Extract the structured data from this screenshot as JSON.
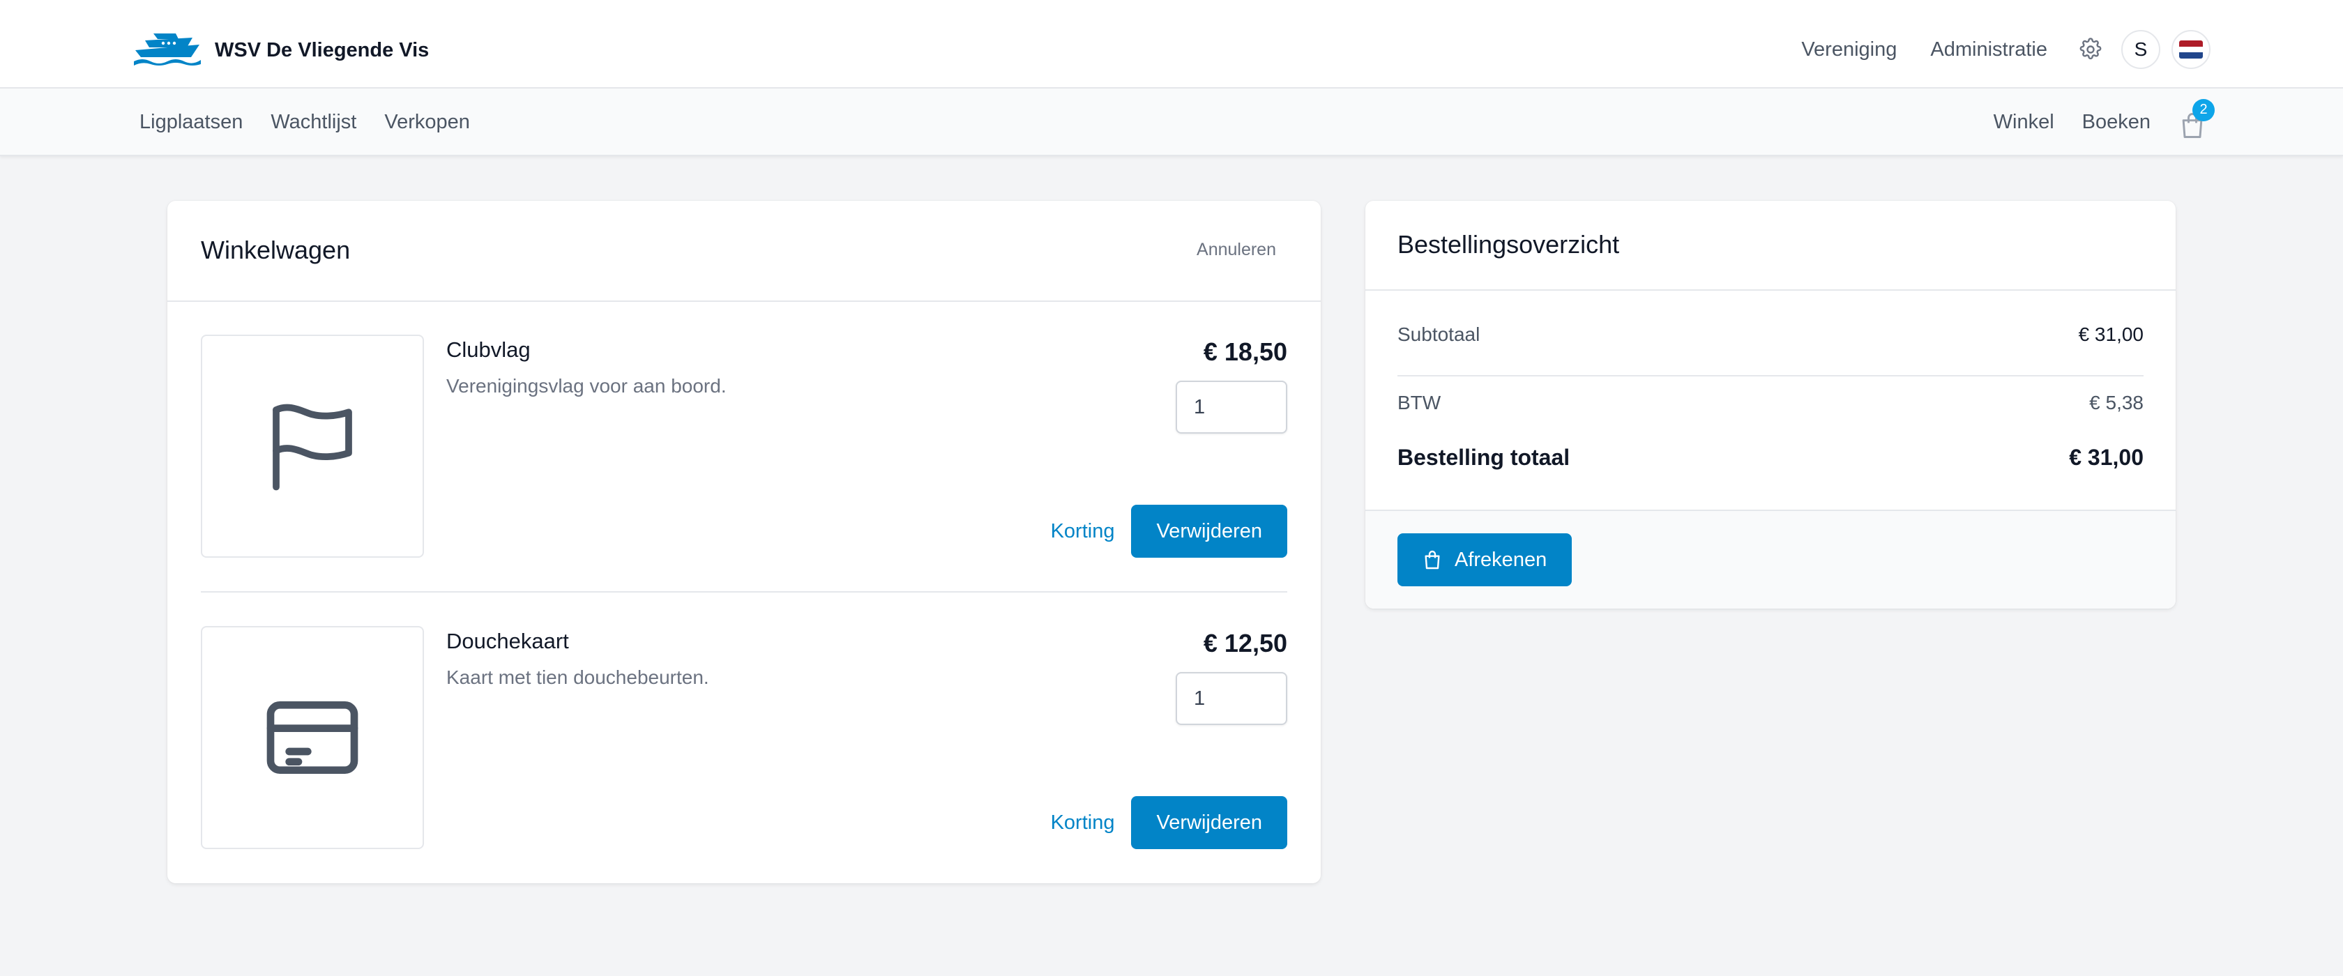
{
  "brand": {
    "name": "WSV De Vliegende Vis",
    "logo_icon": "boat-logo-icon",
    "color": "#0284c7"
  },
  "topnav": {
    "items": [
      "Vereniging",
      "Administratie"
    ],
    "settings_icon": "gear-icon",
    "avatar_initial": "S",
    "language_flag": "netherlands-flag-icon"
  },
  "subnav": {
    "left": [
      "Ligplaatsen",
      "Wachtlijst",
      "Verkopen"
    ],
    "right": [
      "Winkel",
      "Boeken"
    ],
    "cart_icon": "shopping-bag-icon",
    "cart_count": "2"
  },
  "cart": {
    "title": "Winkelwagen",
    "cancel_label": "Annuleren",
    "items": [
      {
        "name": "Clubvlag",
        "description": "Verenigingsvlag voor aan boord.",
        "price": "€ 18,50",
        "quantity": "1",
        "icon": "flag-icon",
        "discount_label": "Korting",
        "remove_label": "Verwijderen"
      },
      {
        "name": "Douchekaart",
        "description": "Kaart met tien douchebeurten.",
        "price": "€ 12,50",
        "quantity": "1",
        "icon": "credit-card-icon",
        "discount_label": "Korting",
        "remove_label": "Verwijderen"
      }
    ]
  },
  "summary": {
    "title": "Bestellingsoverzicht",
    "subtotal_label": "Subtotaal",
    "subtotal_value": "€ 31,00",
    "tax_label": "BTW",
    "tax_value": "€ 5,38",
    "total_label": "Bestelling totaal",
    "total_value": "€ 31,00",
    "checkout_label": "Afrekenen",
    "checkout_icon": "shopping-bag-icon"
  },
  "colors": {
    "accent": "#0284c7",
    "badge": "#0ea5e9",
    "background": "#f3f4f6"
  }
}
